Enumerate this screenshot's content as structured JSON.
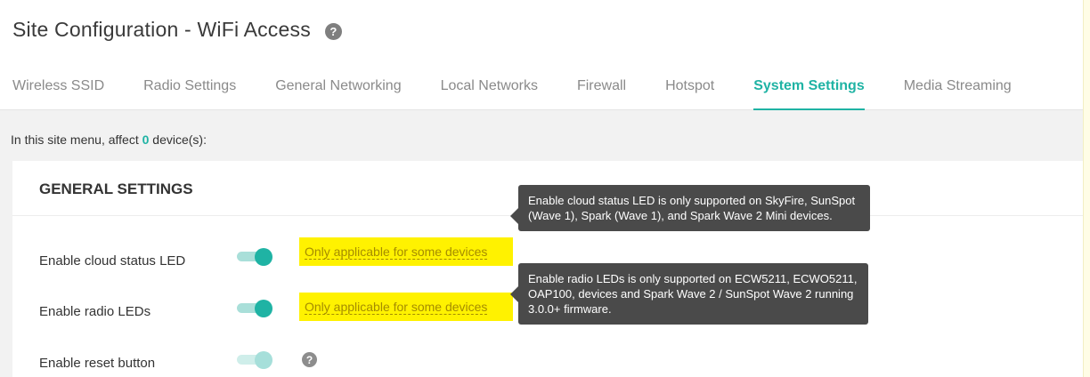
{
  "header": {
    "title": "Site Configuration - WiFi Access",
    "help_icon": "?"
  },
  "tabs": [
    {
      "label": "Wireless SSID"
    },
    {
      "label": "Radio Settings"
    },
    {
      "label": "General Networking"
    },
    {
      "label": "Local Networks"
    },
    {
      "label": "Firewall"
    },
    {
      "label": "Hotspot"
    },
    {
      "label": "System Settings",
      "active": true
    },
    {
      "label": "Media Streaming"
    }
  ],
  "affect": {
    "prefix": "In this site menu, affect ",
    "count": "0",
    "suffix": " device(s):"
  },
  "section": {
    "title": "GENERAL SETTINGS",
    "rows": [
      {
        "label": "Enable cloud status LED",
        "enabled": true,
        "note": "Only applicable for some devices"
      },
      {
        "label": "Enable radio LEDs",
        "enabled": true,
        "note": "Only applicable for some devices"
      },
      {
        "label": "Enable reset button",
        "enabled": true,
        "disabled_look": true,
        "help": "?"
      }
    ]
  },
  "tooltips": [
    {
      "text": "Enable cloud status LED is only supported on SkyFire, SunSpot (Wave 1), Spark (Wave 1), and Spark Wave 2 Mini devices."
    },
    {
      "text": "Enable radio LEDs is only supported on ECW5211, ECWO5211, OAP100, devices and Spark Wave 2 / SunSpot Wave 2 running 3.0.0+ firmware."
    }
  ],
  "colors": {
    "accent": "#1fb3a4",
    "highlight": "#fff200",
    "tooltip_bg": "#4a4a4a"
  }
}
